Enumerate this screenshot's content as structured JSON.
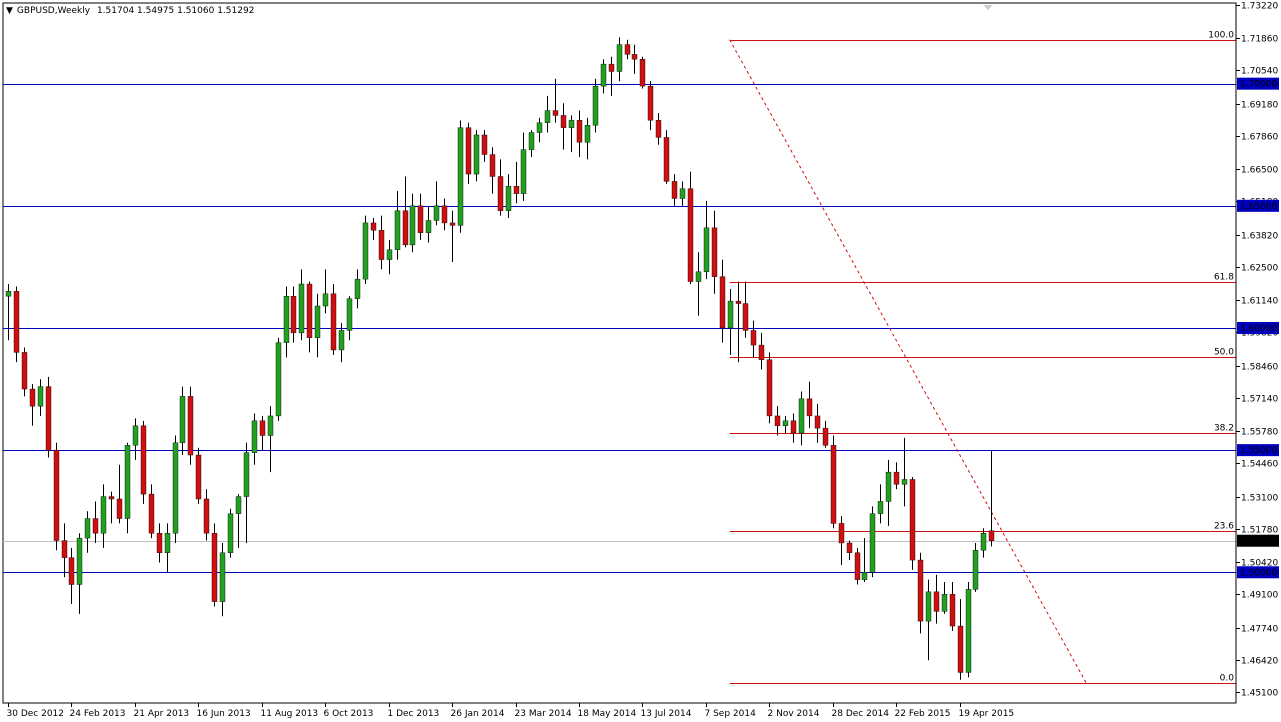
{
  "header": {
    "symbol": "GBPUSD,Weekly",
    "ohlc": "1.51704 1.54975 1.51060 1.51292",
    "menu_icon": "triangle-down-icon"
  },
  "chart_data": {
    "type": "candlestick",
    "symbol": "GBPUSD",
    "timeframe": "Weekly",
    "ylim": [
      1.451,
      1.7322
    ],
    "y_ticks": [
      1.7322,
      1.7186,
      1.7054,
      1.6918,
      1.6786,
      1.665,
      1.6518,
      1.6382,
      1.625,
      1.6114,
      1.5982,
      1.5846,
      1.5714,
      1.5578,
      1.5446,
      1.531,
      1.5178,
      1.5042,
      1.491,
      1.4774,
      1.4642,
      1.451
    ],
    "x_ticks": [
      "30 Dec 2012",
      "24 Feb 2013",
      "21 Apr 2013",
      "16 Jun 2013",
      "11 Aug 2013",
      "6 Oct 2013",
      "1 Dec 2013",
      "26 Jan 2014",
      "23 Mar 2014",
      "18 May 2014",
      "13 Jul 2014",
      "7 Sep 2014",
      "2 Nov 2014",
      "28 Dec 2014",
      "22 Feb 2015",
      "19 Apr 2015"
    ],
    "current_price": "1.51292",
    "horizontal_levels": [
      {
        "value": 1.7,
        "label": "1.70000"
      },
      {
        "value": 1.65,
        "label": "1.65000"
      },
      {
        "value": 1.6,
        "label": "1.60000"
      },
      {
        "value": 1.55,
        "label": "1.55000"
      },
      {
        "value": 1.5,
        "label": "1.50000"
      }
    ],
    "fibonacci": [
      {
        "label": "100.0",
        "value": 1.718
      },
      {
        "label": "61.8",
        "value": 1.619
      },
      {
        "label": "50.0",
        "value": 1.588
      },
      {
        "label": "38.2",
        "value": 1.557
      },
      {
        "label": "23.6",
        "value": 1.517
      },
      {
        "label": "0.0",
        "value": 1.4545
      }
    ],
    "fib_start_week": 91,
    "trendline": {
      "from": [
        91,
        1.718
      ],
      "to": [
        136,
        1.4545
      ]
    },
    "colors": {
      "up": "#22a022",
      "down": "#d01010",
      "levels": "#0000c0",
      "fib": "#d01010",
      "price_line": "#c0c0c0",
      "axis": "#000000"
    },
    "candles": [
      [
        1.613,
        1.618,
        1.595,
        1.615
      ],
      [
        1.615,
        1.617,
        1.586,
        1.59
      ],
      [
        1.59,
        1.592,
        1.572,
        1.575
      ],
      [
        1.575,
        1.577,
        1.56,
        1.568
      ],
      [
        1.568,
        1.579,
        1.564,
        1.576
      ],
      [
        1.576,
        1.58,
        1.547,
        1.55
      ],
      [
        1.55,
        1.553,
        1.509,
        1.513
      ],
      [
        1.513,
        1.52,
        1.498,
        1.506
      ],
      [
        1.506,
        1.51,
        1.487,
        1.495
      ],
      [
        1.495,
        1.516,
        1.483,
        1.514
      ],
      [
        1.514,
        1.525,
        1.508,
        1.522
      ],
      [
        1.522,
        1.529,
        1.512,
        1.516
      ],
      [
        1.516,
        1.536,
        1.51,
        1.531
      ],
      [
        1.531,
        1.533,
        1.52,
        1.53
      ],
      [
        1.53,
        1.544,
        1.52,
        1.522
      ],
      [
        1.522,
        1.553,
        1.516,
        1.552
      ],
      [
        1.552,
        1.563,
        1.546,
        1.56
      ],
      [
        1.56,
        1.562,
        1.528,
        1.532
      ],
      [
        1.532,
        1.536,
        1.514,
        1.516
      ],
      [
        1.516,
        1.52,
        1.504,
        1.508
      ],
      [
        1.508,
        1.52,
        1.5,
        1.516
      ],
      [
        1.516,
        1.556,
        1.512,
        1.553
      ],
      [
        1.553,
        1.576,
        1.548,
        1.572
      ],
      [
        1.572,
        1.576,
        1.544,
        1.548
      ],
      [
        1.548,
        1.551,
        1.528,
        1.53
      ],
      [
        1.53,
        1.534,
        1.513,
        1.516
      ],
      [
        1.516,
        1.52,
        1.486,
        1.488
      ],
      [
        1.488,
        1.512,
        1.482,
        1.508
      ],
      [
        1.508,
        1.526,
        1.506,
        1.524
      ],
      [
        1.524,
        1.532,
        1.51,
        1.531
      ],
      [
        1.531,
        1.553,
        1.512,
        1.549
      ],
      [
        1.549,
        1.565,
        1.544,
        1.562
      ],
      [
        1.562,
        1.564,
        1.55,
        1.556
      ],
      [
        1.556,
        1.568,
        1.541,
        1.564
      ],
      [
        1.564,
        1.596,
        1.562,
        1.594
      ],
      [
        1.594,
        1.617,
        1.588,
        1.613
      ],
      [
        1.613,
        1.617,
        1.594,
        1.598
      ],
      [
        1.598,
        1.624,
        1.595,
        1.618
      ],
      [
        1.618,
        1.619,
        1.59,
        1.596
      ],
      [
        1.596,
        1.614,
        1.588,
        1.609
      ],
      [
        1.609,
        1.624,
        1.606,
        1.614
      ],
      [
        1.614,
        1.618,
        1.589,
        1.591
      ],
      [
        1.591,
        1.602,
        1.586,
        1.599
      ],
      [
        1.599,
        1.613,
        1.595,
        1.612
      ],
      [
        1.612,
        1.624,
        1.608,
        1.62
      ],
      [
        1.62,
        1.646,
        1.618,
        1.643
      ],
      [
        1.643,
        1.645,
        1.636,
        1.64
      ],
      [
        1.64,
        1.646,
        1.624,
        1.628
      ],
      [
        1.628,
        1.636,
        1.622,
        1.632
      ],
      [
        1.632,
        1.656,
        1.628,
        1.648
      ],
      [
        1.648,
        1.662,
        1.633,
        1.634
      ],
      [
        1.634,
        1.655,
        1.631,
        1.65
      ],
      [
        1.65,
        1.655,
        1.636,
        1.639
      ],
      [
        1.639,
        1.65,
        1.635,
        1.644
      ],
      [
        1.644,
        1.66,
        1.642,
        1.65
      ],
      [
        1.65,
        1.653,
        1.64,
        1.643
      ],
      [
        1.643,
        1.648,
        1.627,
        1.642
      ],
      [
        1.642,
        1.685,
        1.639,
        1.682
      ],
      [
        1.682,
        1.684,
        1.659,
        1.663
      ],
      [
        1.663,
        1.681,
        1.66,
        1.679
      ],
      [
        1.679,
        1.681,
        1.668,
        1.671
      ],
      [
        1.671,
        1.674,
        1.655,
        1.662
      ],
      [
        1.662,
        1.669,
        1.646,
        1.648
      ],
      [
        1.648,
        1.663,
        1.645,
        1.658
      ],
      [
        1.658,
        1.668,
        1.651,
        1.655
      ],
      [
        1.655,
        1.68,
        1.652,
        1.673
      ],
      [
        1.673,
        1.681,
        1.67,
        1.68
      ],
      [
        1.68,
        1.686,
        1.676,
        1.684
      ],
      [
        1.684,
        1.695,
        1.68,
        1.689
      ],
      [
        1.689,
        1.702,
        1.684,
        1.687
      ],
      [
        1.687,
        1.692,
        1.673,
        1.682
      ],
      [
        1.682,
        1.687,
        1.672,
        1.685
      ],
      [
        1.685,
        1.689,
        1.67,
        1.676
      ],
      [
        1.676,
        1.686,
        1.669,
        1.683
      ],
      [
        1.683,
        1.702,
        1.68,
        1.699
      ],
      [
        1.699,
        1.71,
        1.696,
        1.708
      ],
      [
        1.708,
        1.711,
        1.695,
        1.705
      ],
      [
        1.705,
        1.719,
        1.701,
        1.716
      ],
      [
        1.716,
        1.718,
        1.71,
        1.712
      ],
      [
        1.712,
        1.716,
        1.704,
        1.71
      ],
      [
        1.71,
        1.711,
        1.698,
        1.699
      ],
      [
        1.699,
        1.701,
        1.681,
        1.685
      ],
      [
        1.685,
        1.688,
        1.675,
        1.678
      ],
      [
        1.678,
        1.681,
        1.659,
        1.66
      ],
      [
        1.66,
        1.663,
        1.65,
        1.653
      ],
      [
        1.653,
        1.66,
        1.65,
        1.657
      ],
      [
        1.657,
        1.664,
        1.618,
        1.619
      ],
      [
        1.619,
        1.631,
        1.605,
        1.623
      ],
      [
        1.623,
        1.652,
        1.62,
        1.641
      ],
      [
        1.641,
        1.648,
        1.614,
        1.621
      ],
      [
        1.621,
        1.628,
        1.594,
        1.6
      ],
      [
        1.6,
        1.616,
        1.589,
        1.611
      ],
      [
        1.611,
        1.619,
        1.586,
        1.61
      ],
      [
        1.61,
        1.619,
        1.596,
        1.599
      ],
      [
        1.599,
        1.603,
        1.588,
        1.593
      ],
      [
        1.593,
        1.598,
        1.583,
        1.587
      ],
      [
        1.587,
        1.59,
        1.561,
        1.564
      ],
      [
        1.564,
        1.568,
        1.556,
        1.56
      ],
      [
        1.56,
        1.564,
        1.557,
        1.562
      ],
      [
        1.562,
        1.565,
        1.553,
        1.557
      ],
      [
        1.557,
        1.574,
        1.552,
        1.571
      ],
      [
        1.571,
        1.578,
        1.559,
        1.564
      ],
      [
        1.564,
        1.569,
        1.553,
        1.559
      ],
      [
        1.559,
        1.562,
        1.551,
        1.552
      ],
      [
        1.552,
        1.556,
        1.518,
        1.52
      ],
      [
        1.52,
        1.523,
        1.503,
        1.512
      ],
      [
        1.512,
        1.513,
        1.505,
        1.508
      ],
      [
        1.508,
        1.51,
        1.495,
        1.497
      ],
      [
        1.497,
        1.514,
        1.496,
        1.5
      ],
      [
        1.5,
        1.527,
        1.498,
        1.524
      ],
      [
        1.524,
        1.536,
        1.52,
        1.529
      ],
      [
        1.529,
        1.546,
        1.519,
        1.541
      ],
      [
        1.541,
        1.545,
        1.534,
        1.536
      ],
      [
        1.536,
        1.555,
        1.527,
        1.538
      ],
      [
        1.538,
        1.539,
        1.501,
        1.505
      ],
      [
        1.505,
        1.508,
        1.475,
        1.48
      ],
      [
        1.48,
        1.497,
        1.464,
        1.492
      ],
      [
        1.492,
        1.499,
        1.479,
        1.484
      ],
      [
        1.484,
        1.496,
        1.483,
        1.491
      ],
      [
        1.491,
        1.496,
        1.476,
        1.478
      ],
      [
        1.478,
        1.489,
        1.456,
        1.459
      ],
      [
        1.459,
        1.496,
        1.457,
        1.493
      ],
      [
        1.493,
        1.512,
        1.492,
        1.509
      ],
      [
        1.509,
        1.518,
        1.506,
        1.516
      ],
      [
        1.517,
        1.5497,
        1.5106,
        1.5129
      ]
    ]
  }
}
